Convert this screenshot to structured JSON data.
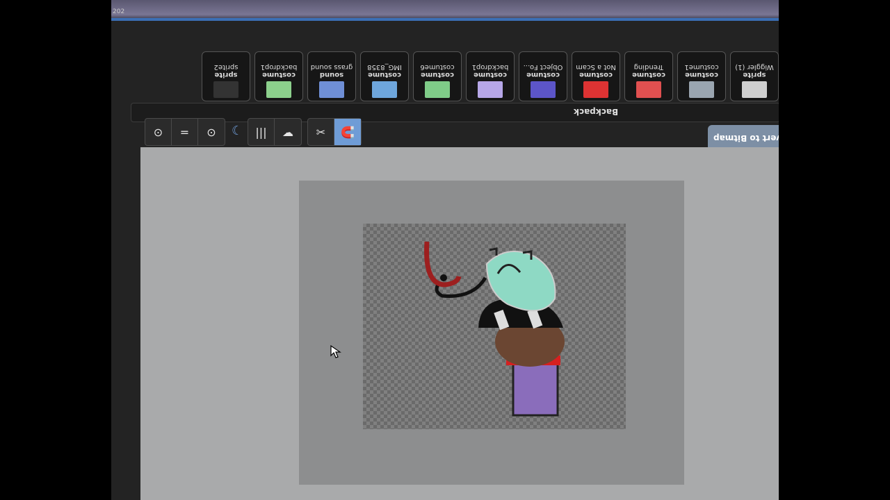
{
  "window": {
    "corner_text": "202"
  },
  "backpack": {
    "label": "Backpack",
    "items": [
      {
        "type": "sprite",
        "name": "Wiggler (1)",
        "thumb_color": "#cfcfcf"
      },
      {
        "type": "costume",
        "name": "costume1",
        "thumb_color": "#9aa5b0"
      },
      {
        "type": "costume",
        "name": "Trending",
        "thumb_color": "#e05050"
      },
      {
        "type": "costume",
        "name": "Not a Scam",
        "thumb_color": "#d33"
      },
      {
        "type": "costume",
        "name": "Object Fo...",
        "thumb_color": "#5c55c8"
      },
      {
        "type": "costume",
        "name": "backdrop1",
        "thumb_color": "#b7a7e8"
      },
      {
        "type": "costume",
        "name": "costume6",
        "thumb_color": "#7fcc88"
      },
      {
        "type": "costume",
        "name": "IMG_8358",
        "thumb_color": "#6ea6dc"
      },
      {
        "type": "sound",
        "name": "grass sound",
        "thumb_color": "#6f8fd6"
      },
      {
        "type": "costume",
        "name": "backdrop1",
        "thumb_color": "#8cd08c"
      },
      {
        "type": "sprite",
        "name": "sprite2",
        "thumb_color": "#333333"
      }
    ]
  },
  "toolbar": {
    "group1": [
      "⊙",
      "=",
      "⊙"
    ],
    "group2": [
      "|||",
      "☁"
    ],
    "group3": [
      "✂",
      "🧲"
    ]
  },
  "convert_button": {
    "label": "vert to Bitmap"
  },
  "colors": {
    "accent": "#6f9cd6",
    "active_tool": "#6f9cd6"
  }
}
